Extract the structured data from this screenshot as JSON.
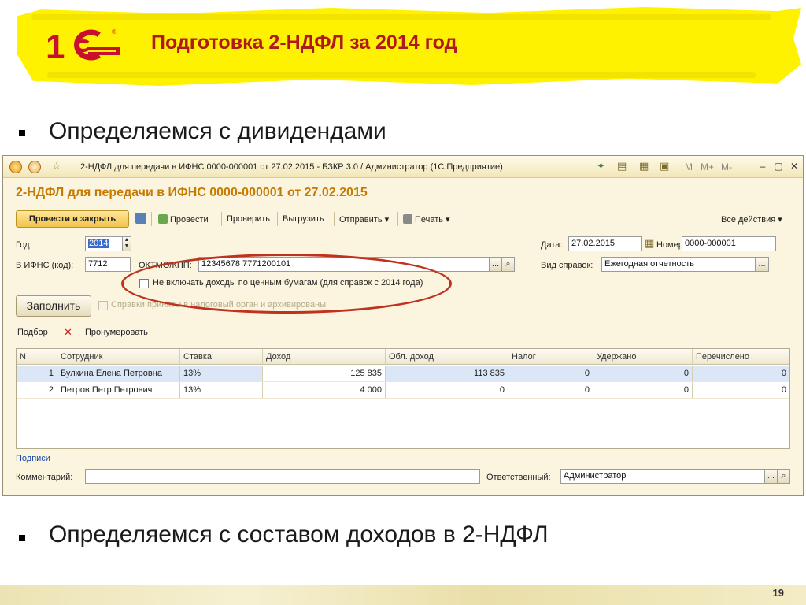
{
  "slide": {
    "title": "Подготовка 2-НДФЛ за 2014 год",
    "bullets": [
      "Определяемся с дивидендами",
      "Определяемся с составом доходов в 2-НДФЛ"
    ],
    "page_number": "19",
    "colors": {
      "banner": "#fff200",
      "title": "#b0191c",
      "logo": "#c8102e",
      "highlight_ellipse": "#c0321e"
    },
    "logo": {
      "text": "1С",
      "registered": "®"
    }
  },
  "window": {
    "title": "2-НДФЛ для передачи в ИФНС 0000-000001 от 27.02.2015 - БЗКР 3.0 / Администратор (1С:Предприятие)",
    "title_buttons": [
      "M",
      "M+",
      "M-"
    ],
    "icons": [
      "app-icon",
      "menu-icon",
      "favorite-star-icon",
      "add-favorite-icon",
      "document-icon",
      "calculator-icon",
      "calendar-icon",
      "minimize-icon",
      "restore-icon",
      "close-icon"
    ]
  },
  "document": {
    "title": "2-НДФЛ для передачи в ИФНС 0000-000001 от 27.02.2015",
    "toolbar": {
      "post_close": "Провести и закрыть",
      "post": "Провести",
      "check": "Проверить",
      "export": "Выгрузить",
      "send": "Отправить",
      "print": "Печать",
      "all_actions": "Все действия"
    },
    "fields": {
      "year_label": "Год:",
      "year_value": "2014",
      "ifns_label": "В ИФНС (код):",
      "ifns_value": "7712",
      "oktmo_label": "ОКТМО/КПП:",
      "oktmo_value": "12345678    7771200101",
      "date_label": "Дата:",
      "date_value": "27.02.2015",
      "number_label": "Номер:",
      "number_value": "0000-000001",
      "report_type_label": "Вид справок:",
      "report_type_value": "Ежегодная отчетность",
      "exclude_securities_label": "Не включать доходы по ценным бумагам (для справок с 2014 года)",
      "exclude_securities_checked": false,
      "accepted_label": "Справки приняты в налоговый орган и архивированы",
      "comment_label": "Комментарий:",
      "comment_value": "",
      "responsible_label": "Ответственный:",
      "responsible_value": "Администратор"
    },
    "fill_button": "Заполнить",
    "table_toolbar": {
      "select": "Подбор",
      "renumber": "Пронумеровать"
    },
    "table": {
      "columns": [
        "N",
        "Сотрудник",
        "Ставка",
        "Доход",
        "Обл. доход",
        "Налог",
        "Удержано",
        "Перечислено"
      ],
      "rows": [
        [
          "1",
          "Булкина Елена Петровна",
          "13%",
          "125 835",
          "113 835",
          "0",
          "0",
          "0"
        ],
        [
          "2",
          "Петров Петр Петрович",
          "13%",
          "4 000",
          "0",
          "0",
          "0",
          "0"
        ]
      ]
    },
    "signatures_link": "Подписи"
  }
}
